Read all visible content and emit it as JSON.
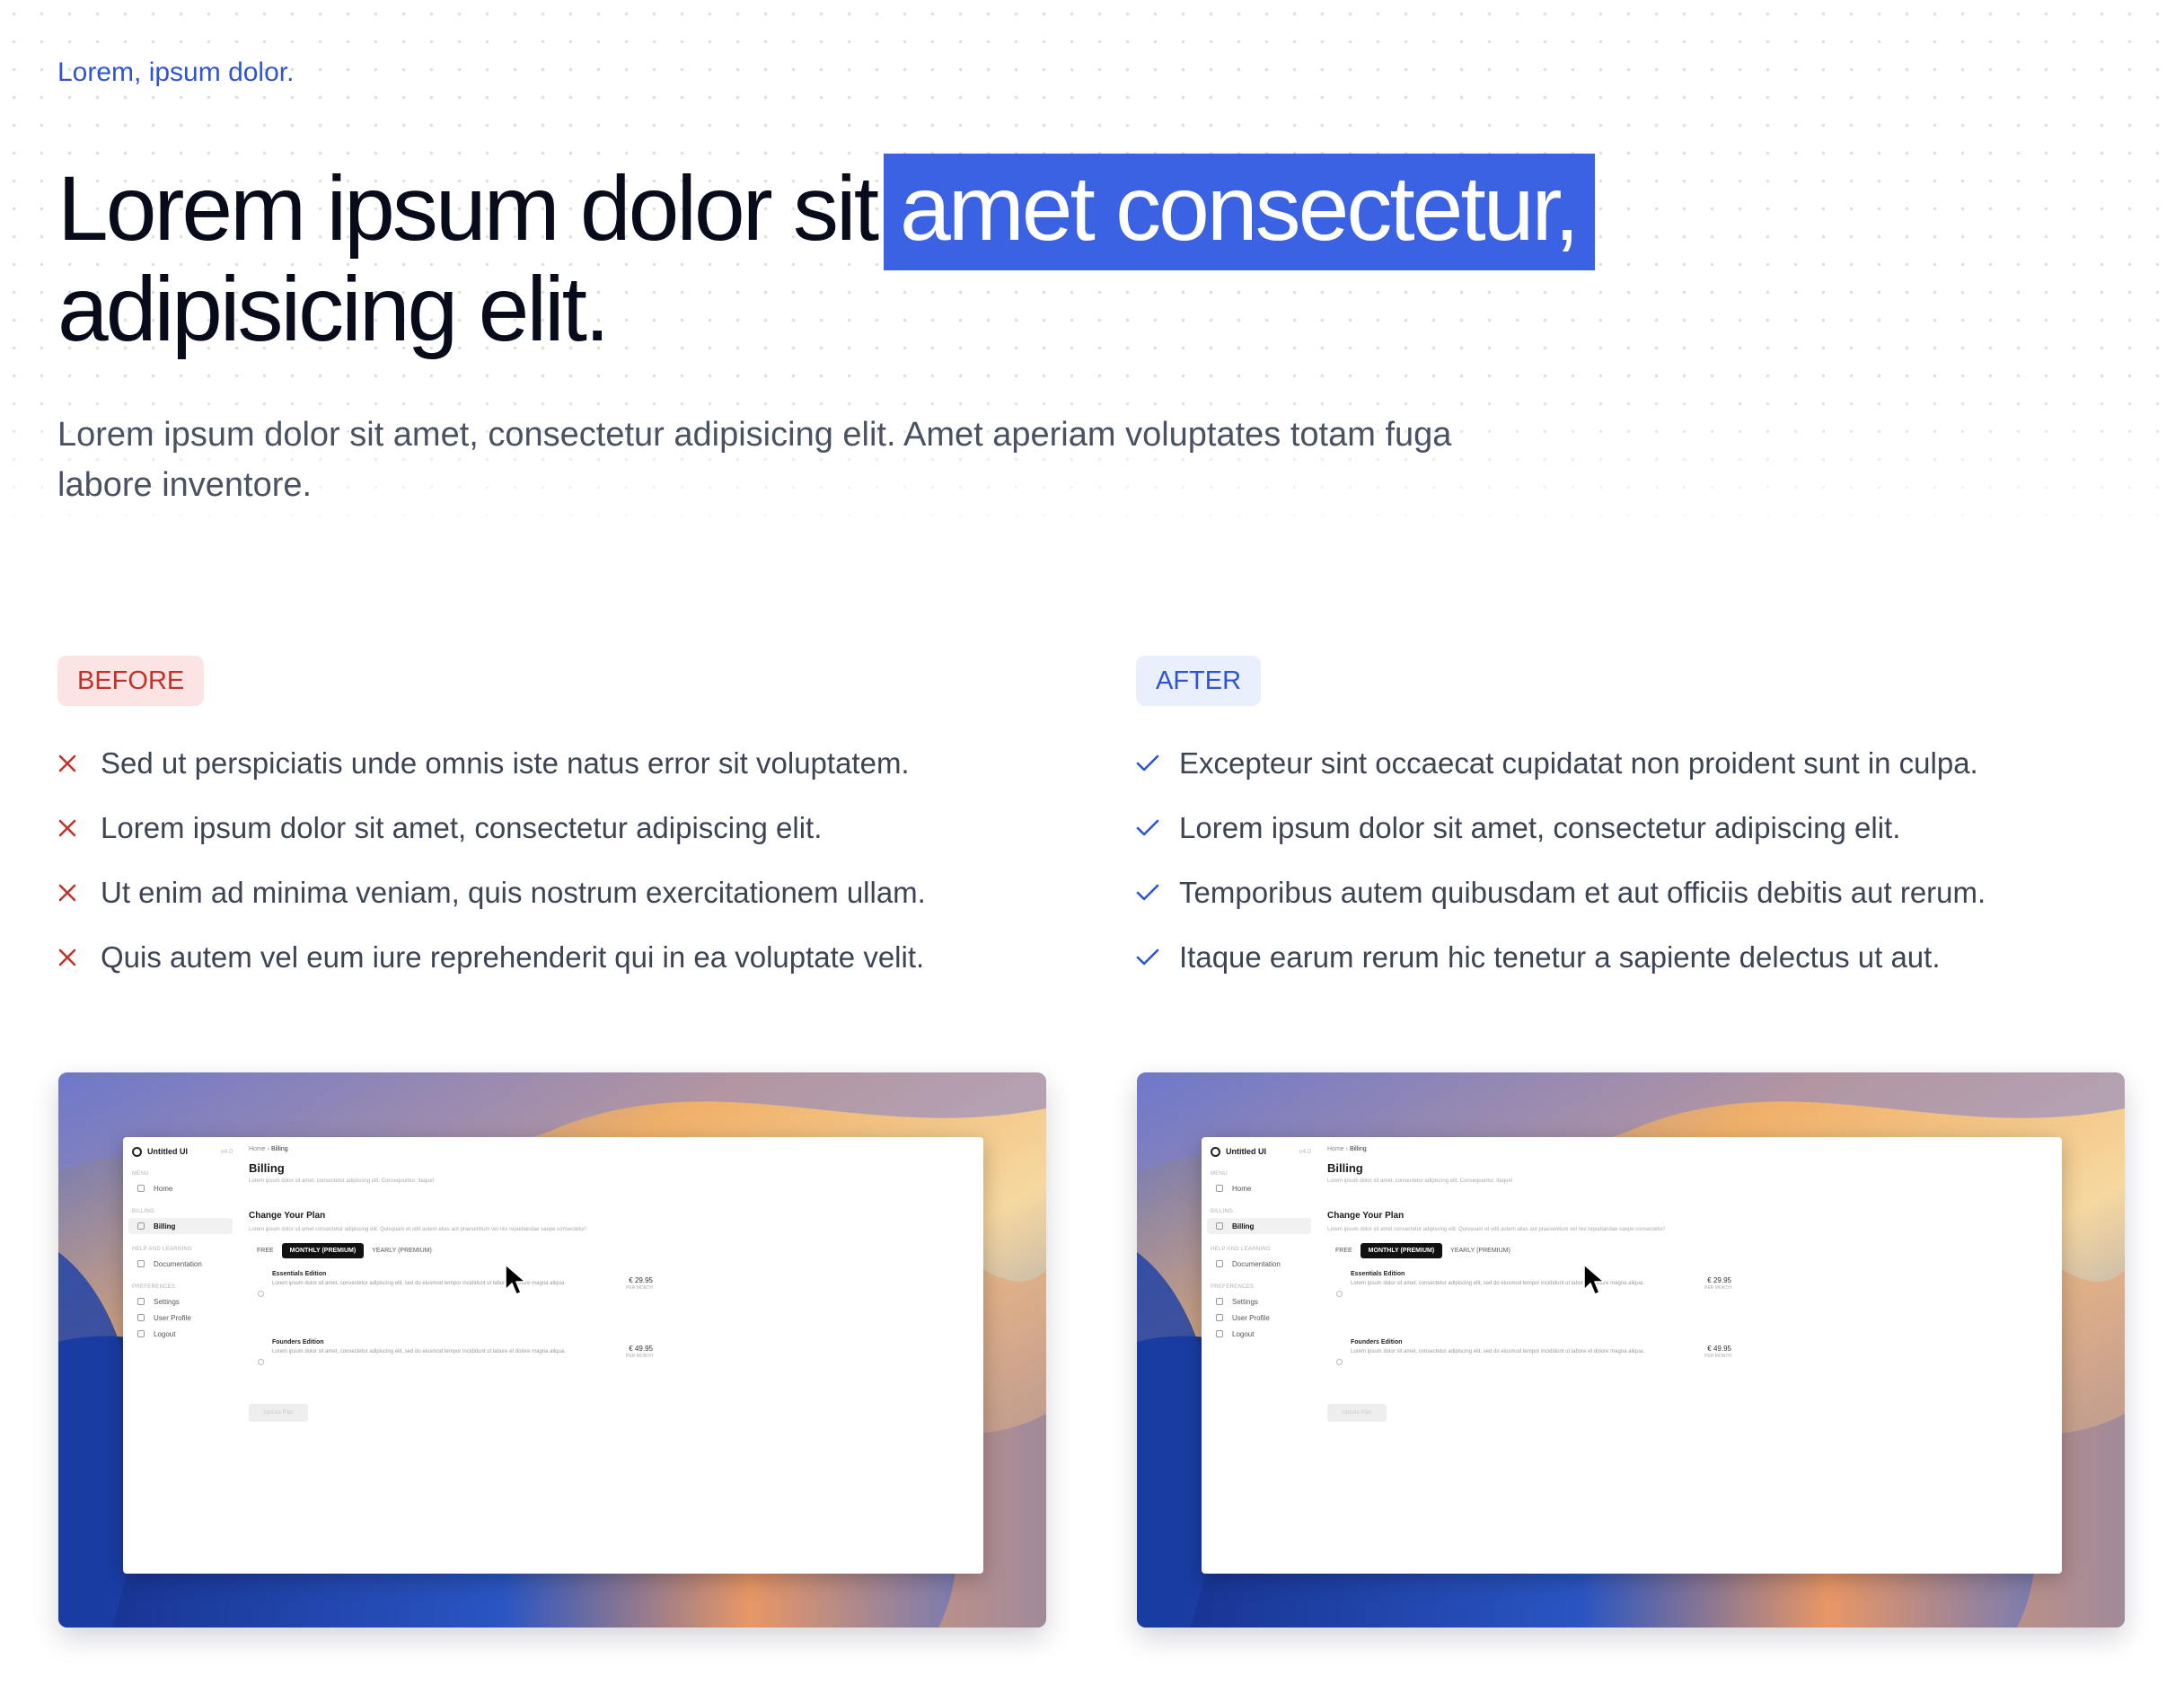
{
  "header": {
    "eyebrow": "Lorem, ipsum dolor.",
    "headline_part1": "Lorem ipsum dolor sit",
    "headline_highlight": "amet consectetur,",
    "headline_part2": "adipisicing elit.",
    "lead": "Lorem ipsum dolor sit amet, consectetur adipisicing elit. Amet aperiam voluptates totam fuga labore inventore."
  },
  "colors": {
    "accent": "#3b62e3",
    "before_badge_bg": "#fde4e4",
    "before_text": "#c0332b",
    "after_badge_bg": "#e9effd",
    "after_text": "#2f55d4"
  },
  "before": {
    "badge": "BEFORE",
    "icon": "x-icon",
    "items": [
      "Sed ut perspiciatis unde omnis iste natus error sit voluptatem.",
      "Lorem ipsum dolor sit amet, consectetur adipiscing elit.",
      "Ut enim ad minima veniam, quis nostrum exercitationem ullam.",
      "Quis autem vel eum iure reprehenderit qui in ea voluptate velit."
    ]
  },
  "after": {
    "badge": "AFTER",
    "icon": "check-icon",
    "items": [
      "Excepteur sint occaecat cupidatat non proident sunt in culpa.",
      "Lorem ipsum dolor sit amet, consectetur adipiscing elit.",
      "Temporibus autem quibusdam et aut officiis debitis aut rerum.",
      "Itaque earum rerum hic tenetur a sapiente delectus ut aut."
    ]
  },
  "screenshot": {
    "app_name": "Untitled UI",
    "version": "v4.0",
    "sections": {
      "menu": "MENU",
      "billing": "BILLING",
      "help": "HELP AND LEARNING",
      "preferences": "PREFERENCES"
    },
    "nav": {
      "home": "Home",
      "billing": "Billing",
      "documentation": "Documentation",
      "settings": "Settings",
      "user_profile": "User Profile",
      "logout": "Logout"
    },
    "breadcrumb": {
      "home": "Home",
      "sep": "›",
      "current": "Billing"
    },
    "page_title": "Billing",
    "page_subtitle": "Lorem ipsum dolor sit amet, consectetur adipiscing elit. Consequuntur, itaque!",
    "section_title": "Change Your Plan",
    "section_desc": "Lorem ipsum dolor sit amet consectetur adipiscing elit. Quisquam et odit autem alias aut praesentium vel nisi repudiandae saepe consectetur!",
    "tabs": [
      "FREE",
      "MONTHLY (PREMIUM)",
      "YEARLY (PREMIUM)"
    ],
    "plans": [
      {
        "name": "Essentials Edition",
        "desc": "Lorem ipsum dolor sit amet, consectetur adipiscing elit, sed do eiusmod tempor incididunt ut labore et dolore magna aliqua.",
        "price": "€ 29.95",
        "period": "PER MONTH"
      },
      {
        "name": "Founders Edition",
        "desc": "Lorem ipsum dolor sit amet, consectetur adipiscing elit, sed do eiusmod tempor incididunt ut labore et dolore magna aliqua.",
        "price": "€ 49.95",
        "period": "PER MONTH"
      }
    ],
    "update_button": "Update Plan"
  }
}
